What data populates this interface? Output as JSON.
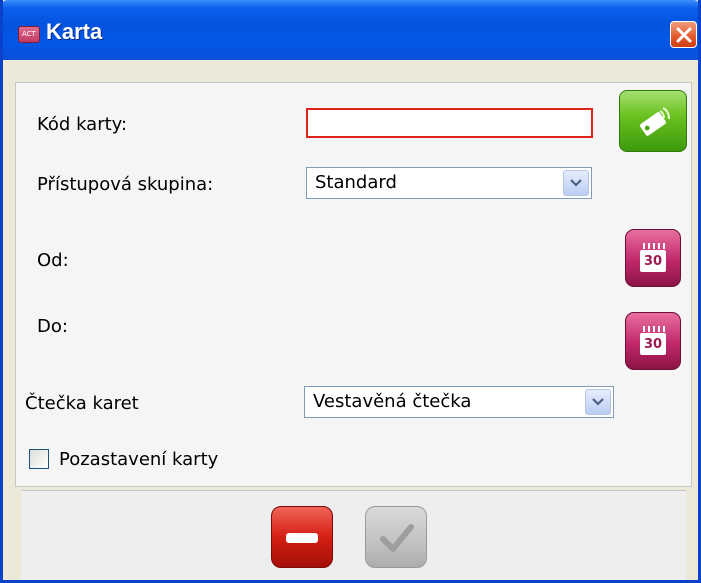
{
  "window": {
    "title": "Karta",
    "app_icon_text": "ACT"
  },
  "form": {
    "card_code_label": "Kód karty:",
    "card_code_value": "",
    "access_group_label": "Přístupová skupina:",
    "access_group_value": "Standard",
    "from_label": "Od:",
    "to_label": "Do:",
    "calendar_day": "30",
    "reader_label": "Čtečka karet",
    "reader_value": "Vestavěná čtečka",
    "suspend_label": "Pozastavení karty",
    "suspend_checked": false
  },
  "icons": {
    "close": "close-icon",
    "read_card": "card-tag-icon",
    "calendar": "calendar-icon",
    "dropdown": "chevron-down-icon",
    "cancel": "minus-icon",
    "confirm": "checkmark-icon"
  },
  "colors": {
    "titlebar": "#0453df",
    "required_border": "#e0231f",
    "read_button": "#6bc221",
    "calendar_button": "#c0276a",
    "cancel_button": "#d51f14",
    "confirm_button_disabled": "#c2c2c2"
  }
}
